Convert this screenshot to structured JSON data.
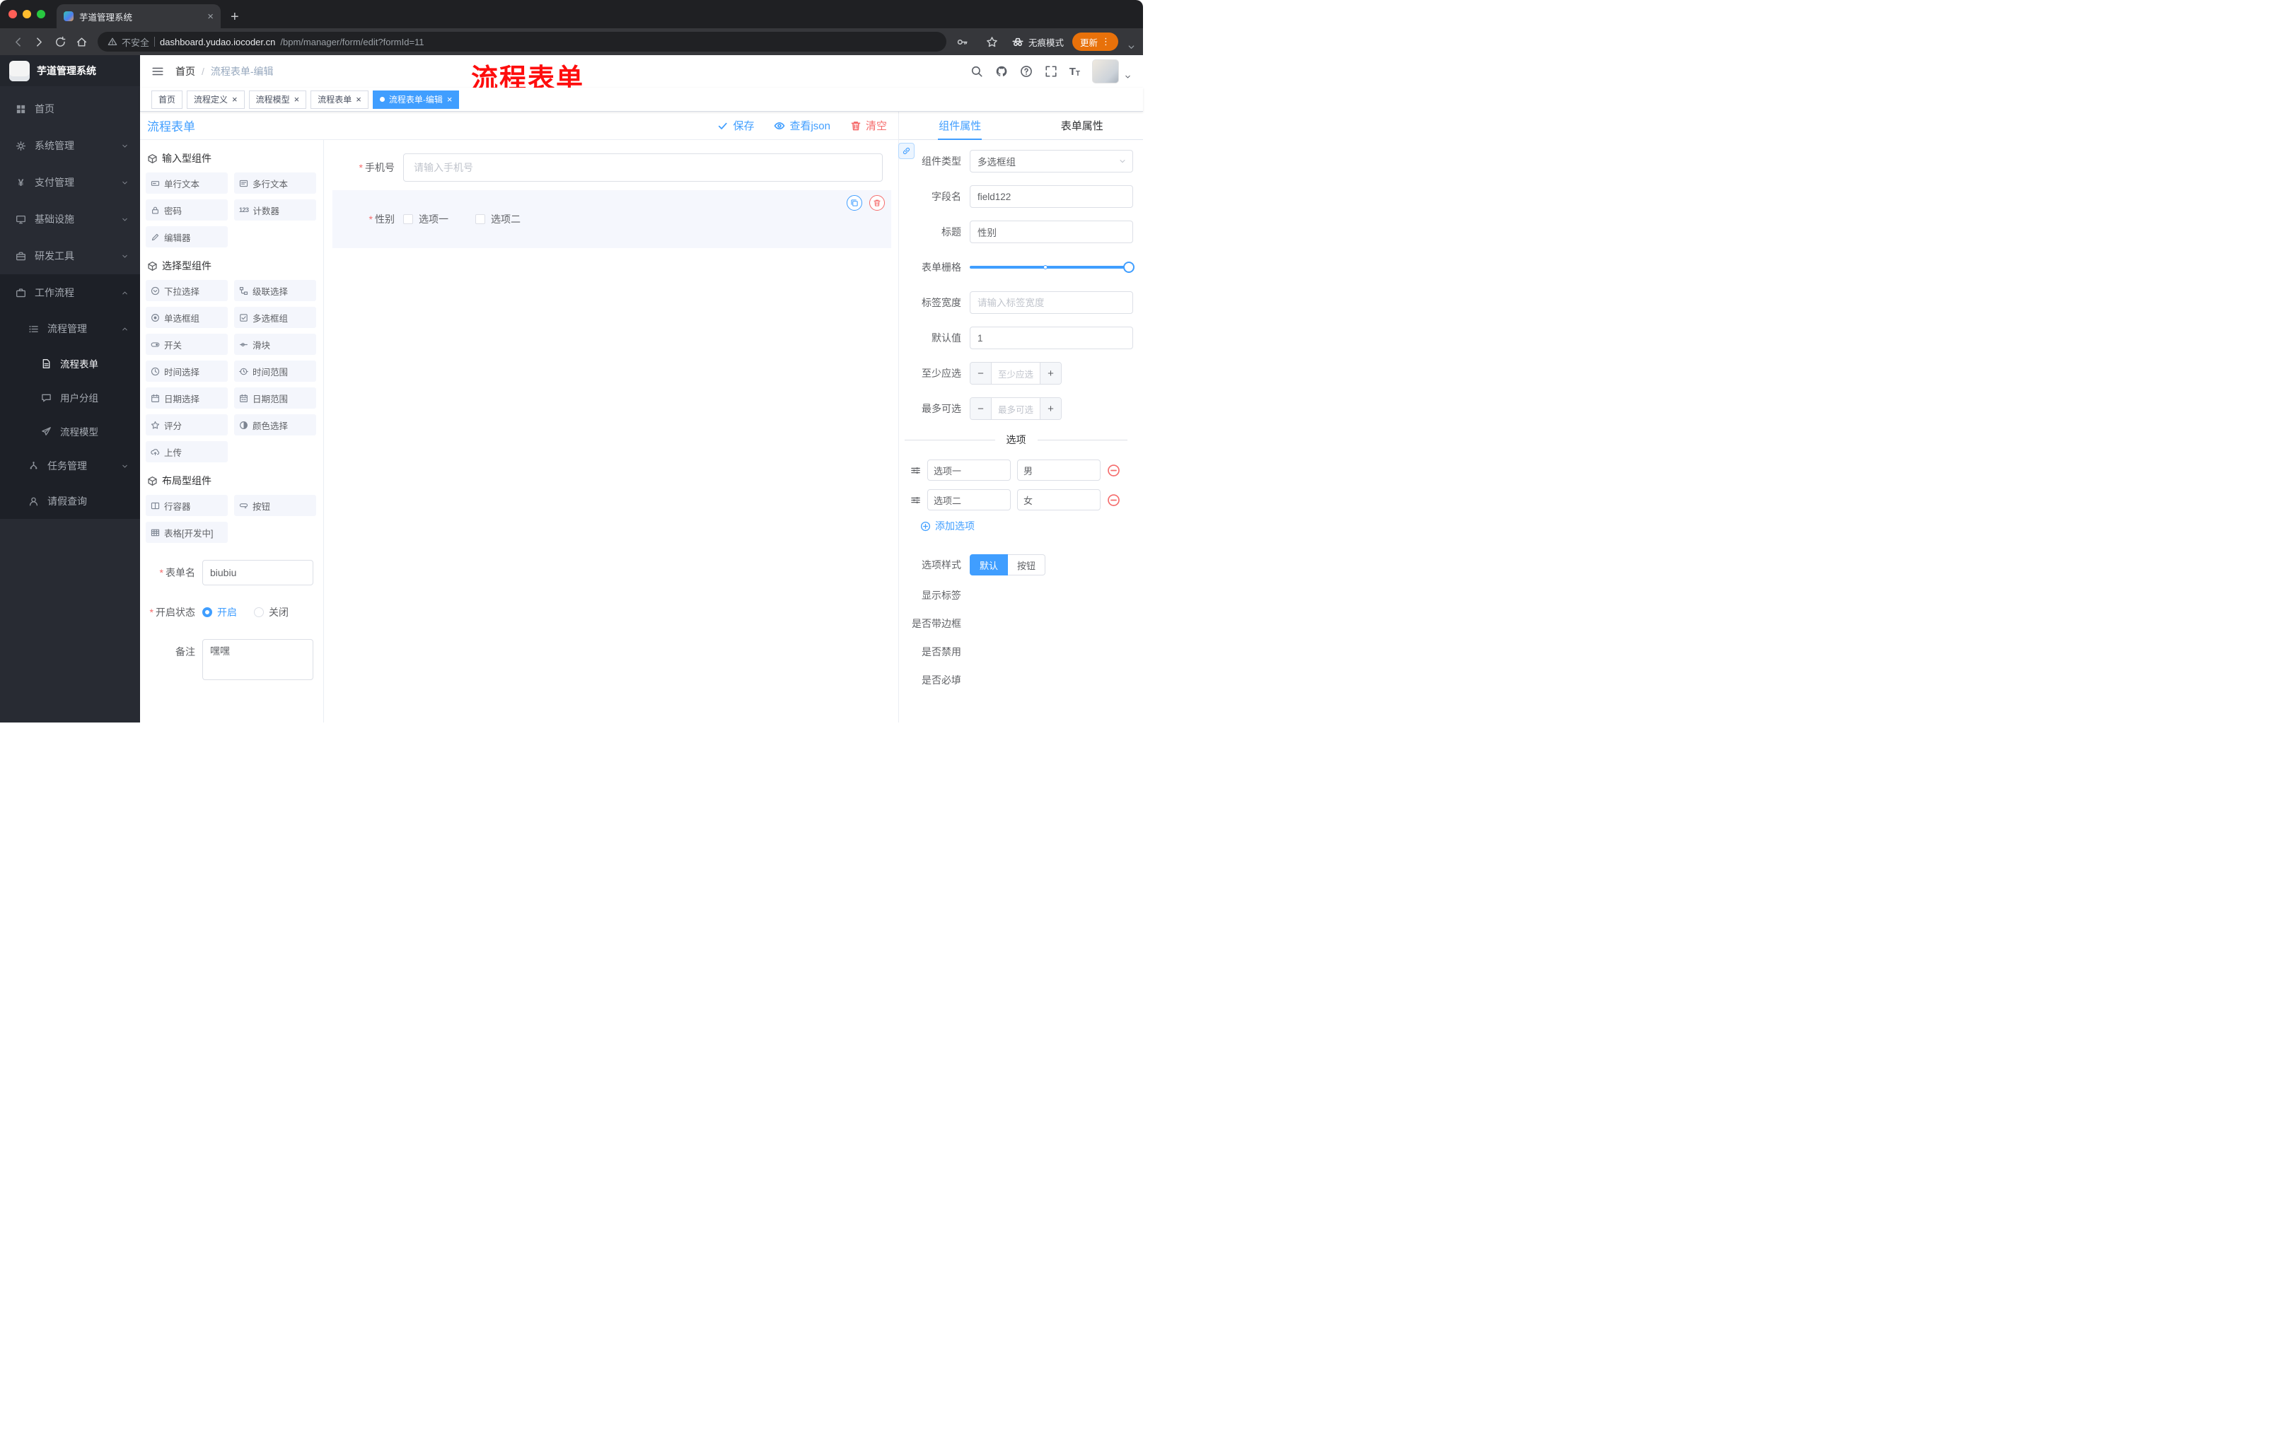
{
  "glyphs": {
    "close": "×",
    "plus": "+",
    "dots_vertical": "⋮",
    "slash": "/",
    "asterisk": "*",
    "counter": "123",
    "minus": "−",
    "plus_sign": "+",
    "yen": "¥",
    "font_size_large": "T",
    "font_size_small": "T"
  },
  "browser": {
    "tab_title": "芋道管理系统",
    "security_label": "不安全",
    "url_domain": "dashboard.yudao.iocoder.cn",
    "url_path": "/bpm/manager/form/edit?formId=11",
    "incognito_label": "无痕模式",
    "update_label": "更新"
  },
  "sidebar": {
    "logo_title": "芋道管理系统",
    "items": [
      {
        "label": "首页"
      },
      {
        "label": "系统管理"
      },
      {
        "label": "支付管理"
      },
      {
        "label": "基础设施"
      },
      {
        "label": "研发工具"
      },
      {
        "label": "工作流程"
      }
    ],
    "submenu": {
      "title": "流程管理",
      "children": [
        {
          "label": "流程表单",
          "active": true
        },
        {
          "label": "用户分组"
        },
        {
          "label": "流程模型"
        }
      ],
      "task_mgmt": "任务管理",
      "leave_query": "请假查询"
    }
  },
  "header": {
    "breadcrumb_home": "首页",
    "breadcrumb_current": "流程表单-编辑",
    "annotation_text": "流程表单",
    "annotation_color": "#ff0000"
  },
  "tags": [
    {
      "label": "首页",
      "closable": false,
      "active": false
    },
    {
      "label": "流程定义",
      "closable": true,
      "active": false
    },
    {
      "label": "流程模型",
      "closable": true,
      "active": false
    },
    {
      "label": "流程表单",
      "closable": true,
      "active": false
    },
    {
      "label": "流程表单-编辑",
      "closable": true,
      "active": true
    }
  ],
  "designer": {
    "title": "流程表单",
    "save": "保存",
    "view_json": "查看json",
    "clear": "清空",
    "groups": [
      {
        "title": "输入型组件",
        "items": [
          {
            "label": "单行文本"
          },
          {
            "label": "多行文本"
          },
          {
            "label": "密码"
          },
          {
            "label": "计数器"
          },
          {
            "label": "编辑器"
          }
        ]
      },
      {
        "title": "选择型组件",
        "items": [
          {
            "label": "下拉选择"
          },
          {
            "label": "级联选择"
          },
          {
            "label": "单选框组"
          },
          {
            "label": "多选框组"
          },
          {
            "label": "开关"
          },
          {
            "label": "滑块"
          },
          {
            "label": "时间选择"
          },
          {
            "label": "时间范围"
          },
          {
            "label": "日期选择"
          },
          {
            "label": "日期范围"
          },
          {
            "label": "评分"
          },
          {
            "label": "颜色选择"
          },
          {
            "label": "上传"
          }
        ]
      },
      {
        "title": "布局型组件",
        "items": [
          {
            "label": "行容器"
          },
          {
            "label": "按钮"
          },
          {
            "label": "表格[开发中]"
          }
        ]
      }
    ],
    "form_config": {
      "name_label": "表单名",
      "name_value": "biubiu",
      "status_label": "开启状态",
      "status_on": "开启",
      "status_off": "关闭",
      "status_value": "开启",
      "remark_label": "备注",
      "remark_value": "嘿嘿"
    }
  },
  "canvas": {
    "phone": {
      "label": "手机号",
      "required": true,
      "placeholder": "请输入手机号"
    },
    "gender": {
      "label": "性别",
      "required": true,
      "selected": true,
      "options": [
        "选项一",
        "选项二"
      ]
    }
  },
  "properties": {
    "tab_component": "组件属性",
    "tab_form": "表单属性",
    "active_tab": "组件属性",
    "component_type": {
      "label": "组件类型",
      "value": "多选框组"
    },
    "field_name": {
      "label": "字段名",
      "value": "field122"
    },
    "title": {
      "label": "标题",
      "value": "性别"
    },
    "form_grid": {
      "label": "表单栅格",
      "slider_at_max": true
    },
    "label_width": {
      "label": "标签宽度",
      "placeholder": "请输入标签宽度"
    },
    "default_value": {
      "label": "默认值",
      "value": "1"
    },
    "min_select": {
      "label": "至少应选",
      "placeholder": "至少应选"
    },
    "max_select": {
      "label": "最多可选",
      "placeholder": "最多可选"
    },
    "options_divider": "选项",
    "options": [
      {
        "label": "选项一",
        "value": "男"
      },
      {
        "label": "选项二",
        "value": "女"
      }
    ],
    "add_option": "添加选项",
    "option_style": {
      "label": "选项样式",
      "default": "默认",
      "button": "按钮",
      "value": "默认"
    },
    "switches": [
      {
        "label": "显示标签",
        "on": true
      },
      {
        "label": "是否带边框",
        "on": false
      },
      {
        "label": "是否禁用",
        "on": false
      },
      {
        "label": "是否必填",
        "on": true
      }
    ]
  },
  "colors": {
    "accent": "#409eff",
    "danger": "#f56c6c",
    "annotation": "#ff0000",
    "update_pill": "#e8710a"
  }
}
